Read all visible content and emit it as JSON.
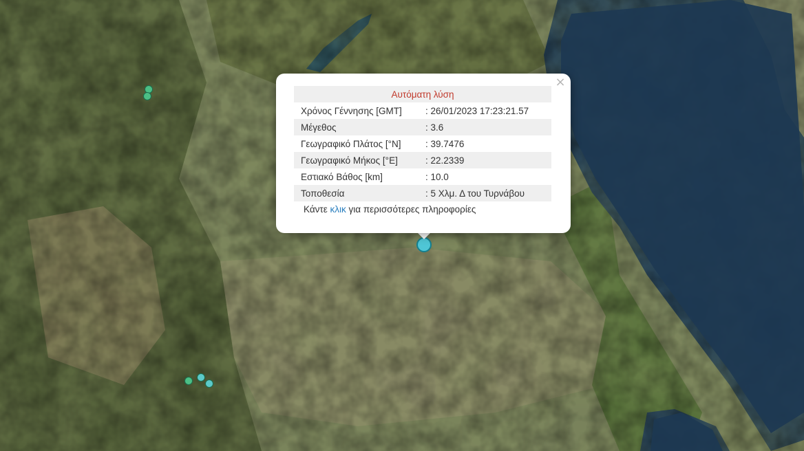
{
  "popup": {
    "title": "Αυτόματη λύση",
    "rows": [
      {
        "label": "Χρόνος Γέννησης [GMT]",
        "value": ": 26/01/2023 17:23:21.57"
      },
      {
        "label": "Μέγεθος",
        "value": ": 3.6"
      },
      {
        "label": "Γεωγραφικό Πλάτος [°N]",
        "value": ": 39.7476"
      },
      {
        "label": "Γεωγραφικό Μήκος [°E]",
        "value": ": 22.2339"
      },
      {
        "label": "Εστιακό Βάθος [km]",
        "value": ": 10.0"
      },
      {
        "label": "Τοποθεσία",
        "value": ": 5 Χλμ. Δ του Τυρνάβου"
      }
    ],
    "more_prefix": "Κάντε",
    "more_link": "κλικ",
    "more_suffix": "για περισσότερες πληροφορίες",
    "close_icon": "×"
  },
  "colors": {
    "sea": "#1e3a54",
    "land": "#6f7a4c",
    "marker_main": "#4fc6d6",
    "marker_green": "#4cbf85",
    "marker_cyan": "#5cc9c9",
    "title_red": "#c0392b",
    "link_blue": "#2a7fbf"
  },
  "markers": [
    {
      "kind": "small",
      "color": "marker_green"
    },
    {
      "kind": "small",
      "color": "marker_green"
    },
    {
      "kind": "small",
      "color": "marker_green"
    },
    {
      "kind": "small",
      "color": "marker_cyan"
    },
    {
      "kind": "small",
      "color": "marker_cyan"
    },
    {
      "kind": "main",
      "color": "marker_main"
    }
  ]
}
